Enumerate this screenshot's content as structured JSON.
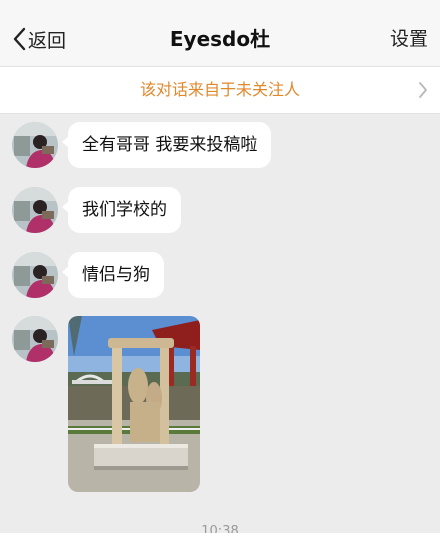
{
  "nav": {
    "back_label": "返回",
    "title": "Eyesdo杜",
    "settings_label": "设置"
  },
  "notice": {
    "text": "该对话来自于未关注人"
  },
  "messages": [
    {
      "type": "text",
      "text": "全有哥哥 我要来投稿啦"
    },
    {
      "type": "text",
      "text": "我们学校的"
    },
    {
      "type": "text",
      "text": "情侣与狗"
    },
    {
      "type": "image",
      "description": "wooden-sculpture-photo"
    }
  ],
  "timestamp": "10:38",
  "colors": {
    "nav_bg": "#f7f7f7",
    "chat_bg": "#ececec",
    "notice_text": "#e0892c",
    "bubble_bg": "#ffffff"
  }
}
